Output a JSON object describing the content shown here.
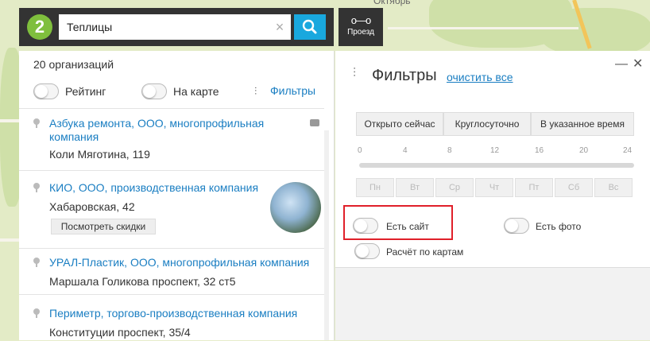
{
  "map": {
    "place_label": "Октябрь"
  },
  "search": {
    "value": "Теплицы",
    "clear_glyph": "×"
  },
  "route": {
    "label": "Проезд"
  },
  "list": {
    "count": "20 организаций",
    "toggle_rating": "Рейтинг",
    "toggle_map": "На карте",
    "filters_link": "Фильтры",
    "items": [
      {
        "title": "Азбука ремонта, ООО, многопрофильная компания",
        "address": "Коли Мяготина, 119"
      },
      {
        "title": "КИО, ООО, производственная компания",
        "address": "Хабаровская, 42",
        "button": "Посмотреть скидки"
      },
      {
        "title": "УРАЛ-Пластик, ООО, многопрофильная компания",
        "address": "Маршала Голикова проспект, 32 ст5"
      },
      {
        "title": "Периметр, торгово-производственная компания",
        "address": "Конституции проспект, 35/4"
      }
    ]
  },
  "filters": {
    "title": "Фильтры",
    "clear_link": "очистить все",
    "time_buttons": [
      "Открыто сейчас",
      "Круглосуточно",
      "В указанное время"
    ],
    "ticks": [
      "0",
      "4",
      "8",
      "12",
      "16",
      "20",
      "24"
    ],
    "days": [
      "Пн",
      "Вт",
      "Ср",
      "Чт",
      "Пт",
      "Сб",
      "Вс"
    ],
    "has_site": "Есть сайт",
    "has_photo": "Есть фото",
    "card_payment": "Расчёт по картам",
    "highlight_color": "#e0202a"
  }
}
